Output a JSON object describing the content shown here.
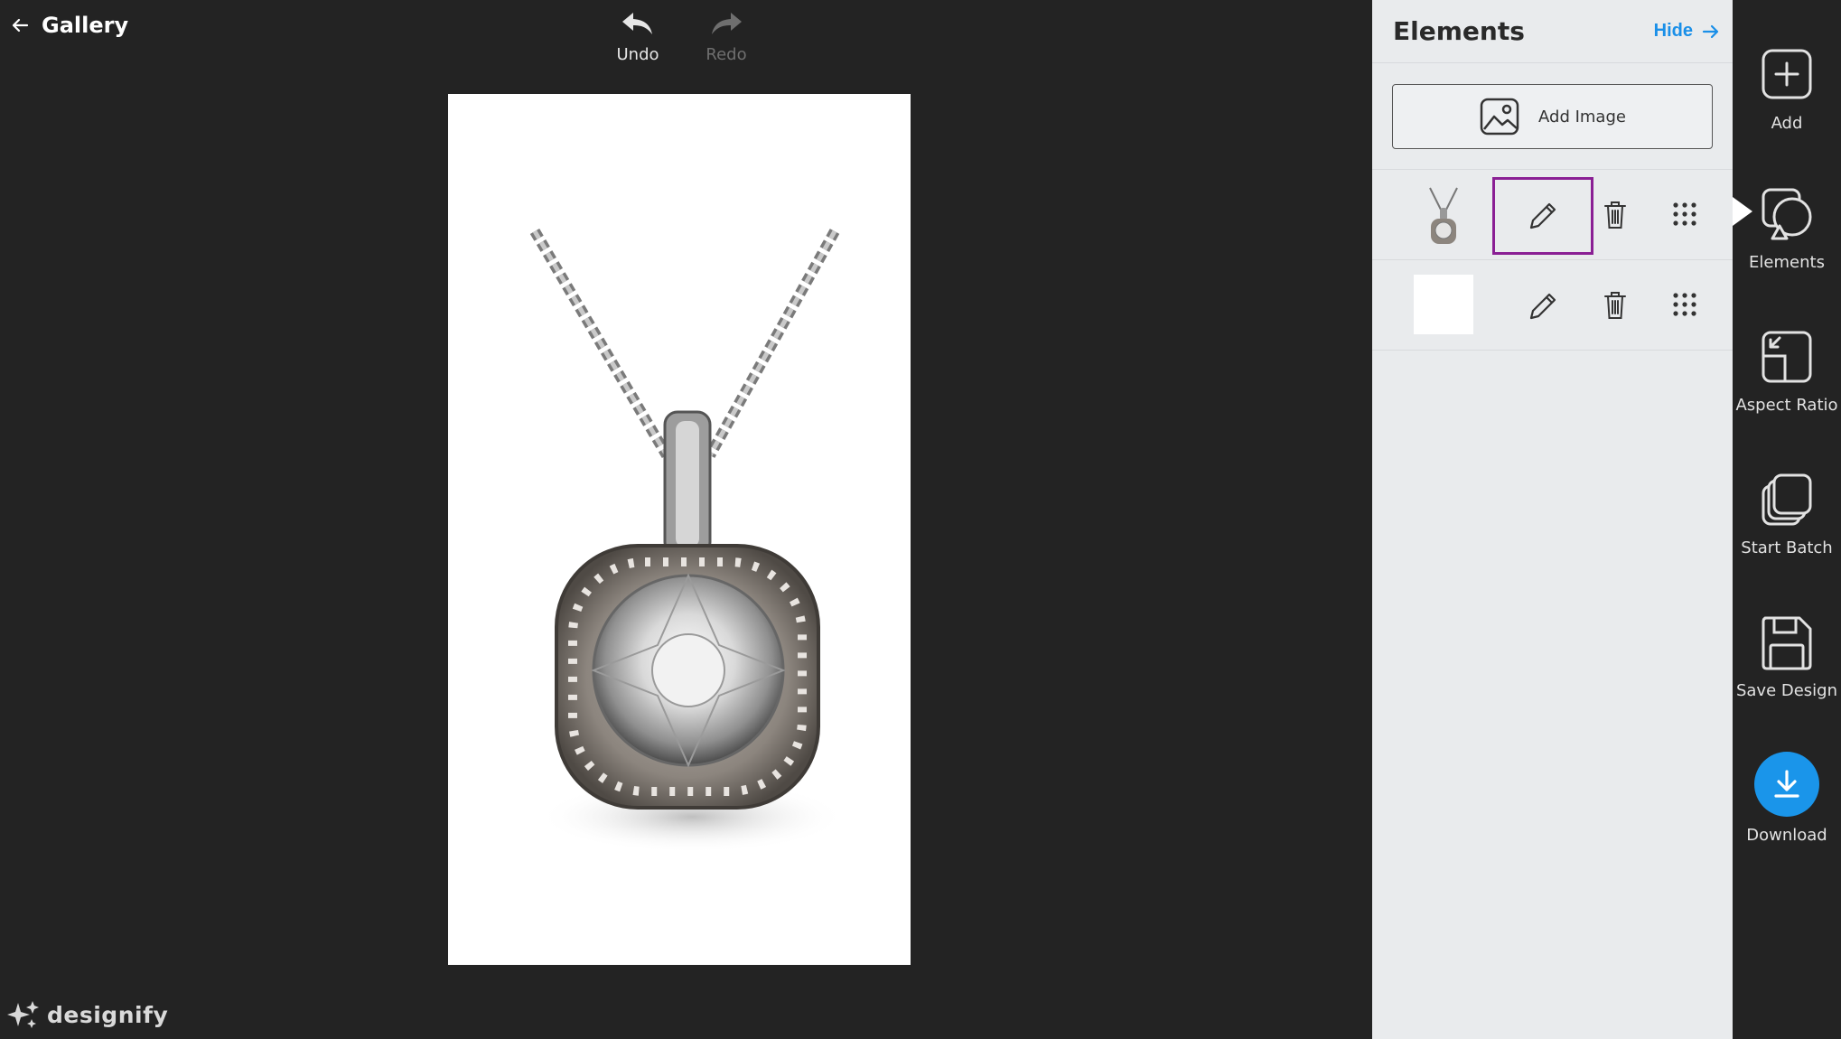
{
  "header": {
    "back_label": "Gallery"
  },
  "history": {
    "undo_label": "Undo",
    "redo_label": "Redo"
  },
  "brand": {
    "name": "designify"
  },
  "panel": {
    "title": "Elements",
    "hide_label": "Hide",
    "add_image_label": "Add Image",
    "layers": [
      {
        "kind": "necklace-thumbnail",
        "edit_selected": true
      },
      {
        "kind": "white-background-thumbnail",
        "edit_selected": false
      }
    ]
  },
  "rail": {
    "items": [
      {
        "label": "Add",
        "icon": "plus-box-icon"
      },
      {
        "label": "Elements",
        "icon": "shapes-icon"
      },
      {
        "label": "Aspect Ratio",
        "icon": "aspect-ratio-icon"
      },
      {
        "label": "Start Batch",
        "icon": "stack-icon"
      },
      {
        "label": "Save Design",
        "icon": "floppy-icon"
      },
      {
        "label": "Download",
        "icon": "download-icon"
      }
    ]
  },
  "colors": {
    "background": "#232323",
    "panel": "#e9ebed",
    "accent_blue": "#1a95ea",
    "selection_purple": "#8a1f94"
  }
}
